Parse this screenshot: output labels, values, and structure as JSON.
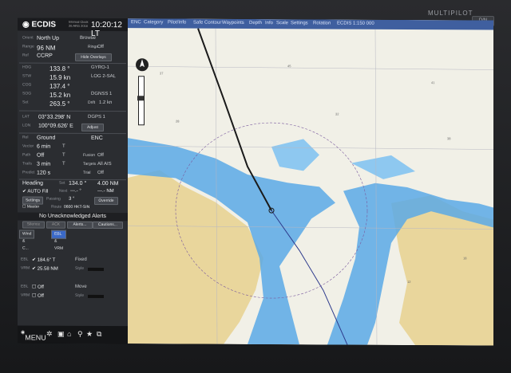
{
  "bezel": {
    "label": "MULTIPILOT",
    "button": "D/N"
  },
  "titlebar": {
    "app": "ECDIS",
    "sub1": "Internal Clock",
    "sub2": "26 ARG 2016",
    "time": "10:20:12 LT"
  },
  "mode": {
    "orient_label": "Orient",
    "orient": "North Up",
    "motion": "Browse",
    "range_label": "Range",
    "range": "96 NM",
    "rings_label": "Rings",
    "rings": "Off",
    "ref_label": "Ref",
    "ref": "CCRP",
    "overlay_btn": "Hide Overlays"
  },
  "nav": {
    "hdg_label": "HDG",
    "hdg": "133.8 °",
    "hdg_src": "GYRO-1",
    "stw_label": "STW",
    "stw": "15.9 kn",
    "stw_src": "LOG 2-SAL",
    "cog_label": "COG",
    "cog": "137.4 °",
    "sog_label": "SOG",
    "sog": "15.2 kn",
    "sog_src": "DGNSS 1",
    "set_label": "Set",
    "set": "263.5 °",
    "drift_label": "Drift",
    "drift": "1.2 kn",
    "lat_label": "LAT",
    "lat": "03°33.298' N",
    "pos_src": "DGPS 1",
    "lon_label": "LON",
    "lon": "100°09.626' E",
    "adjust_btn": "Adjust"
  },
  "display": {
    "rel_label": "Rel",
    "rel": "Ground",
    "chart_type": "ENC",
    "vector_label": "Vector",
    "vector": "6 min",
    "vector_t": "T",
    "path_label": "Path",
    "path": "Off",
    "path_t": "T",
    "fusion_label": "Fusion",
    "fusion": "Off",
    "trails_label": "Trails",
    "trails": "3 min",
    "trails_t": "T",
    "targets_label": "Targets",
    "targets": "All AIS",
    "predict_label": "Predict",
    "predict": "120 s",
    "trial_label": "Trial",
    "trial": "Off"
  },
  "autopilot": {
    "heading_label": "Heading",
    "set_label": "Set",
    "set_val": "134.0 °",
    "set_dist": "4.00 NM",
    "autofill": "AUTO Fill",
    "next_label": "Next",
    "next_val": "---.- °",
    "next_dist": "---.- NM",
    "settings_btn": "Settings",
    "passing": "Passing",
    "passing_val": "3 °",
    "override_btn": "Override",
    "master": "Master",
    "route_label": "Route",
    "route": "0600 HKT-SIN"
  },
  "alerts": {
    "text": "No Unacknowledged Alerts",
    "btn1": "Silence",
    "btn2": "ACK",
    "btn3": "Alerts...",
    "btn4": "Cautions..."
  },
  "tabs": [
    "Wind & C...",
    "EBL & VRM"
  ],
  "ebl": {
    "ebl1": "184.6° T",
    "mode1": "Fixed",
    "vrm1": "25.58 NM",
    "style": "Style",
    "ebl2": "Off",
    "mode2": "Move",
    "vrm2": "Off"
  },
  "bottombar": {
    "menu": "MENU"
  },
  "chartbar": [
    "ENC",
    "Category",
    "Pilot/Info",
    "Safe Contour",
    "Waypoints",
    "Depth",
    "Info",
    "Scale",
    "Settings",
    "Rotation",
    "ECDIS 1:150 000"
  ],
  "colors": {
    "panel": "#2b2d31",
    "shallow": "#5aa9e6",
    "deep_shallow": "#8ec8f0",
    "land": "#e9d69c",
    "deep": "#f1f0e7",
    "route": "#1a1a1a",
    "heading_line": "#2d3a8c"
  }
}
